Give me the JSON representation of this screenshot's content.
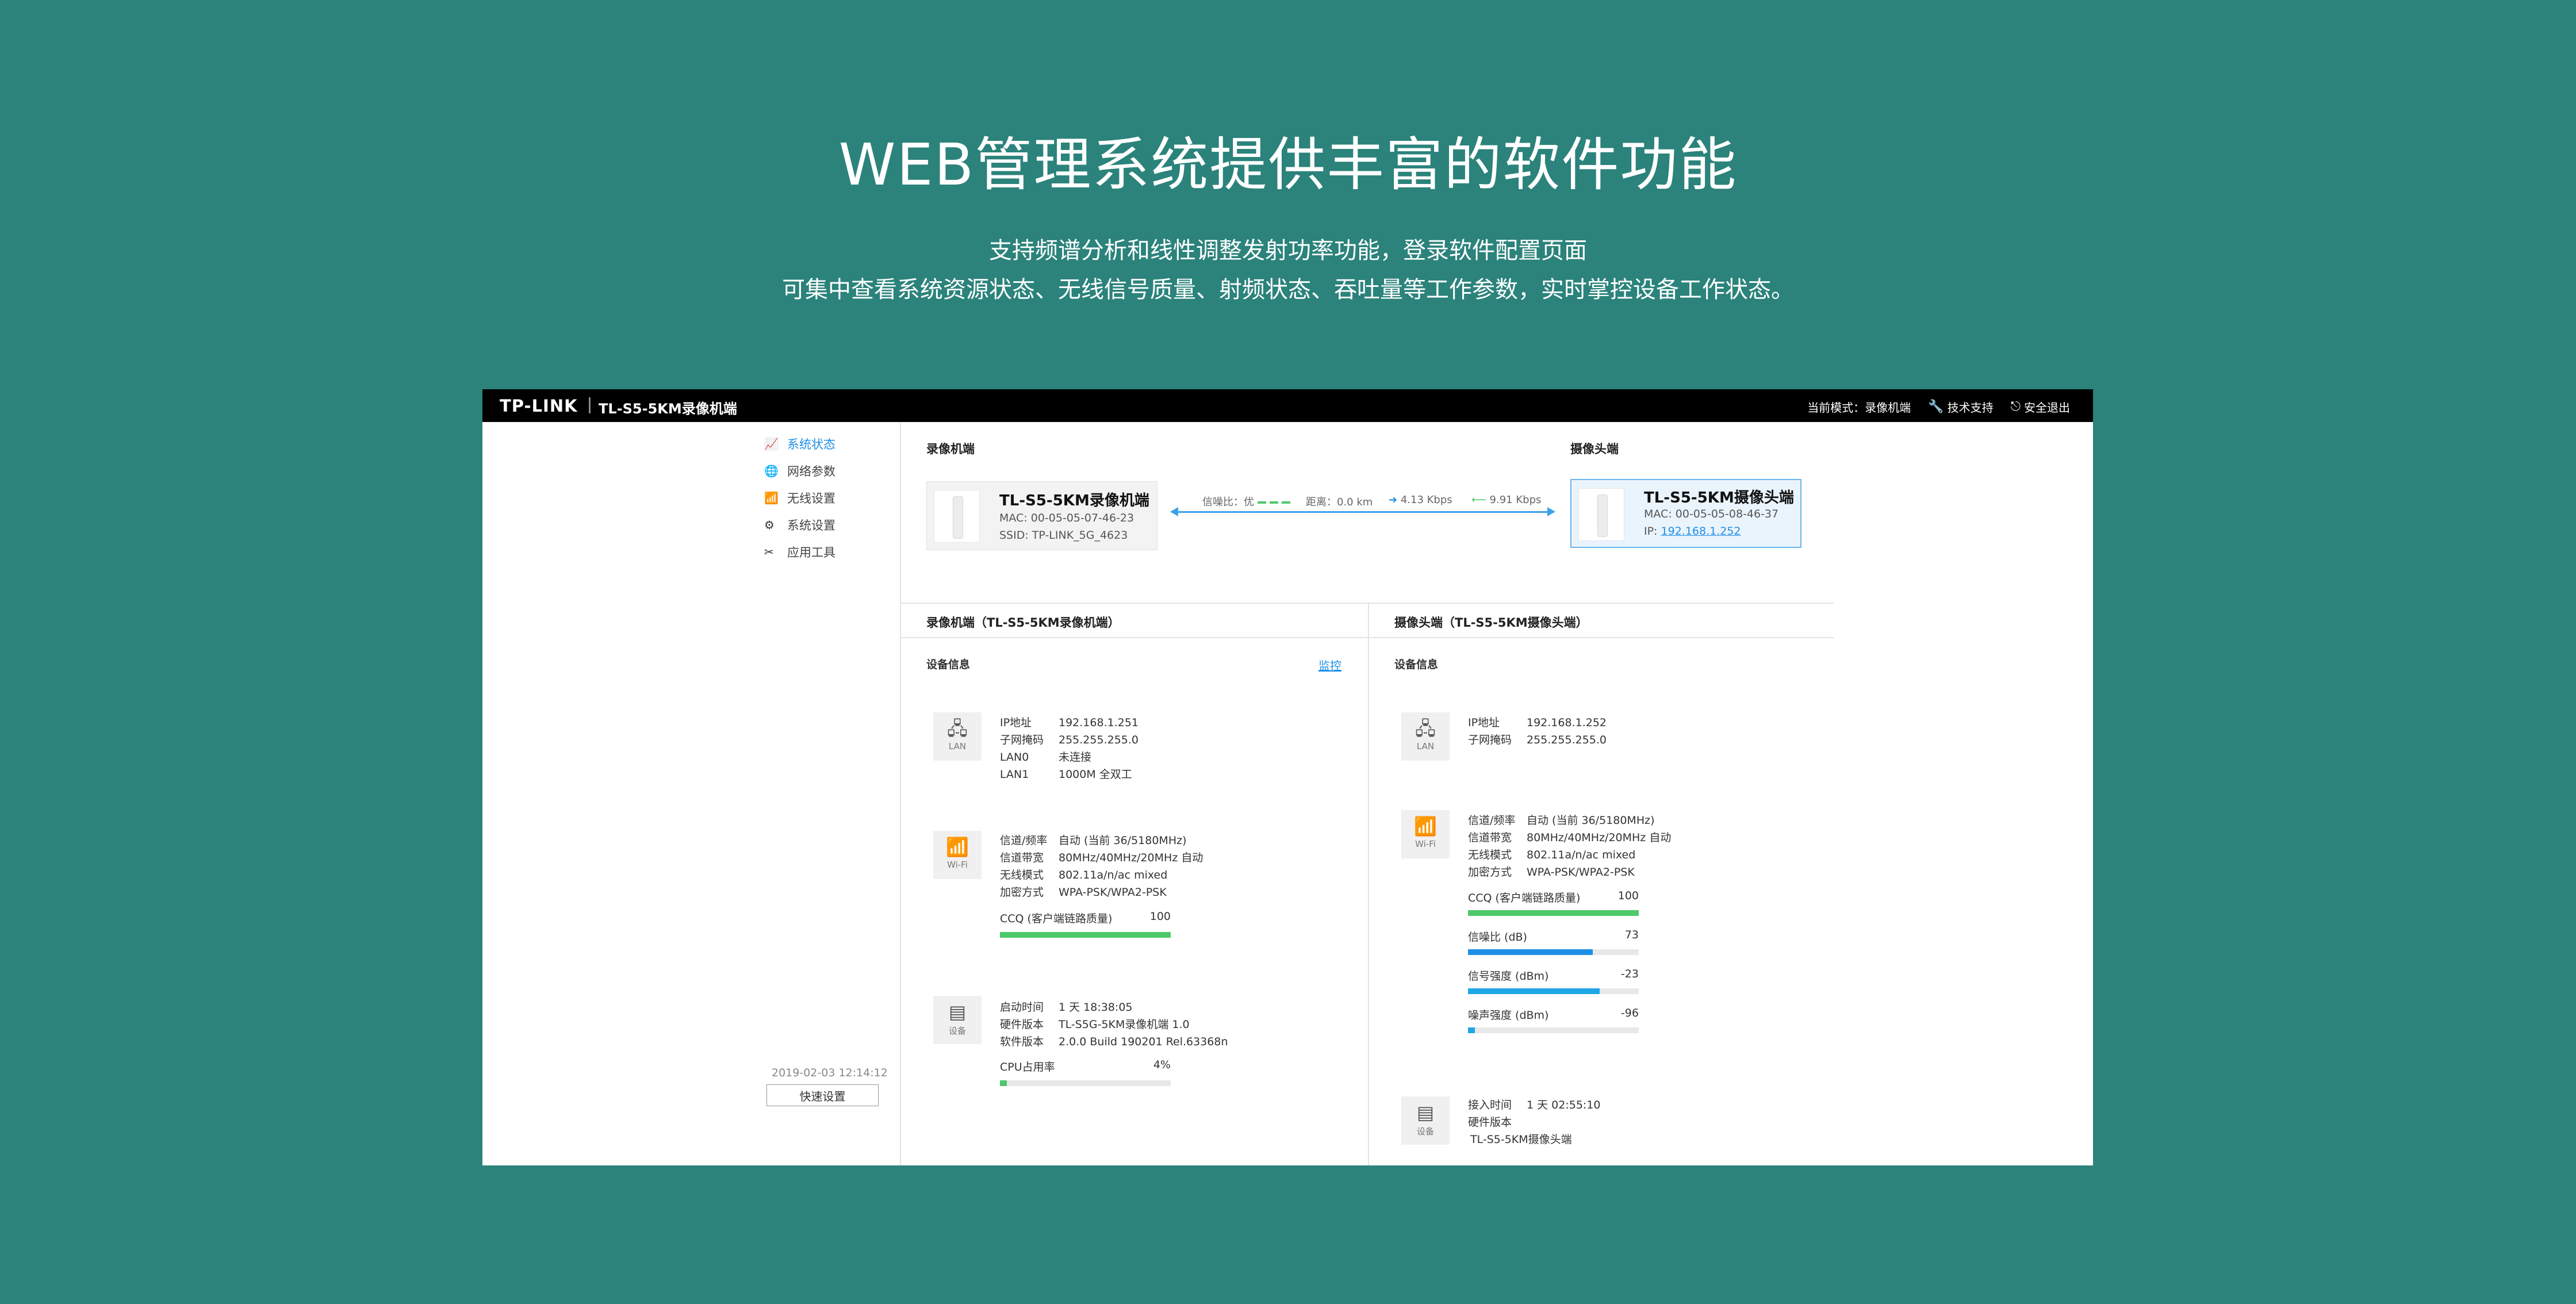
{
  "hero": {
    "title": "WEB管理系统提供丰富的软件功能",
    "line1": "支持频谱分析和线性调整发射功率功能，登录软件配置页面",
    "line2": "可集中查看系统资源状态、无线信号质量、射频状态、吞吐量等工作参数，实时掌控设备工作状态。"
  },
  "topbar": {
    "logo": "TP-LINK",
    "model": "TL-S5-5KM录像机端",
    "mode": "当前模式：录像机端",
    "support": "技术支持",
    "logout": "安全退出"
  },
  "sidebar": {
    "items": [
      {
        "label": "系统状态",
        "icon": "chart-icon"
      },
      {
        "label": "网络参数",
        "icon": "globe-icon"
      },
      {
        "label": "无线设置",
        "icon": "wifi-icon"
      },
      {
        "label": "系统设置",
        "icon": "gear-icon"
      },
      {
        "label": "应用工具",
        "icon": "tools-icon"
      }
    ],
    "datetime": "2019-02-03 12:14:12",
    "quick_button": "快速设置"
  },
  "overview": {
    "recorder_title": "录像机端",
    "camera_title": "摄像头端",
    "recorder": {
      "name": "TL-S5-5KM录像机端",
      "mac": "MAC: 00-05-05-07-46-23",
      "ssid": "SSID: TP-LINK_5G_4623"
    },
    "camera": {
      "name": "TL-S5-5KM摄像头端",
      "mac": "MAC: 00-05-05-08-46-37",
      "ip_label": "IP: ",
      "ip": "192.168.1.252"
    },
    "link": {
      "snr": "信噪比：优",
      "distance": "距离：0.0 km",
      "up": "4.13 Kbps",
      "down": "9.91 Kbps"
    }
  },
  "recorder_panel": {
    "title": "录像机端（TL-S5-5KM录像机端）",
    "device_info": "设备信息",
    "monitor": "监控",
    "lan": {
      "icon_label": "LAN",
      "rows": [
        [
          "IP地址",
          "192.168.1.251"
        ],
        [
          "子网掩码",
          "255.255.255.0"
        ],
        [
          "LAN0",
          "未连接"
        ],
        [
          "LAN1",
          "1000M 全双工"
        ]
      ]
    },
    "wifi": {
      "icon_label": "Wi-Fi",
      "rows": [
        [
          "信道/频率",
          "自动 (当前 36/5180MHz)"
        ],
        [
          "信道带宽",
          "80MHz/40MHz/20MHz 自动"
        ],
        [
          "无线模式",
          "802.11a/n/ac mixed"
        ],
        [
          "加密方式",
          "WPA-PSK/WPA2-PSK"
        ]
      ],
      "ccq_label": "CCQ (客户端链路质量)",
      "ccq_value": "100",
      "ccq_fraction": 1.0
    },
    "device": {
      "icon_label": "设备",
      "rows": [
        [
          "启动时间",
          "1 天 18:38:05"
        ],
        [
          "硬件版本",
          "TL-S5G-5KM录像机端 1.0"
        ],
        [
          "软件版本",
          "2.0.0 Build 190201 Rel.63368n"
        ]
      ],
      "cpu_label": "CPU占用率",
      "cpu_value": "4%",
      "cpu_fraction": 0.04
    }
  },
  "camera_panel": {
    "title": "摄像头端（TL-S5-5KM摄像头端）",
    "device_info": "设备信息",
    "lan": {
      "icon_label": "LAN",
      "rows": [
        [
          "IP地址",
          "192.168.1.252"
        ],
        [
          "子网掩码",
          "255.255.255.0"
        ]
      ]
    },
    "wifi": {
      "icon_label": "Wi-Fi",
      "rows": [
        [
          "信道/频率",
          "自动 (当前 36/5180MHz)"
        ],
        [
          "信道带宽",
          "80MHz/40MHz/20MHz 自动"
        ],
        [
          "无线模式",
          "802.11a/n/ac mixed"
        ],
        [
          "加密方式",
          "WPA-PSK/WPA2-PSK"
        ]
      ],
      "bars": [
        {
          "label": "CCQ (客户端链路质量)",
          "value": "100",
          "fraction": 1.0,
          "color": "#4dc86a"
        },
        {
          "label": "信噪比 (dB)",
          "value": "73",
          "fraction": 0.73,
          "color": "#1e8fe6"
        },
        {
          "label": "信号强度 (dBm)",
          "value": "-23",
          "fraction": 0.77,
          "color": "#1fa6e6"
        },
        {
          "label": "噪声强度 (dBm)",
          "value": "-96",
          "fraction": 0.04,
          "color": "#1fa6e6"
        }
      ]
    },
    "device": {
      "icon_label": "设备",
      "rows": [
        [
          "接入时间",
          "1 天 02:55:10"
        ],
        [
          "硬件版本",
          ""
        ]
      ],
      "hw_value": "TL-S5-5KM摄像头端"
    }
  },
  "colors": {
    "accent": "#1e8fe6",
    "green": "#4dc86a",
    "background": "#2b837b"
  }
}
